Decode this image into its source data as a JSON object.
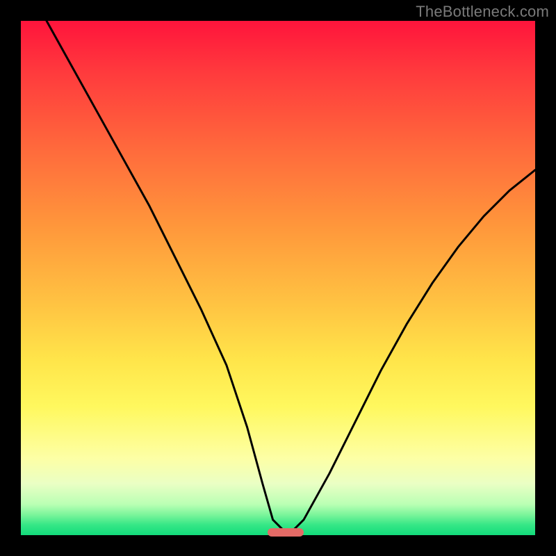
{
  "watermark": "TheBottleneck.com",
  "chart_data": {
    "type": "line",
    "title": "",
    "xlabel": "",
    "ylabel": "",
    "xlim": [
      0,
      100
    ],
    "ylim": [
      0,
      100
    ],
    "grid": false,
    "background_gradient": {
      "direction": "vertical",
      "stops": [
        {
          "pos": 0,
          "color": "#ff143c"
        },
        {
          "pos": 25,
          "color": "#ff6a3c"
        },
        {
          "pos": 55,
          "color": "#ffc342"
        },
        {
          "pos": 75,
          "color": "#fff85e"
        },
        {
          "pos": 96,
          "color": "#7cf59b"
        },
        {
          "pos": 100,
          "color": "#12db7b"
        }
      ]
    },
    "series": [
      {
        "name": "bottleneck-curve",
        "x": [
          5,
          10,
          15,
          20,
          25,
          30,
          35,
          40,
          44,
          47,
          49,
          51,
          53,
          55,
          60,
          65,
          70,
          75,
          80,
          85,
          90,
          95,
          100
        ],
        "y": [
          100,
          91,
          82,
          73,
          64,
          54,
          44,
          33,
          21,
          10,
          3,
          1,
          1,
          3,
          12,
          22,
          32,
          41,
          49,
          56,
          62,
          67,
          71
        ]
      }
    ],
    "marker": {
      "name": "optimal-range",
      "x_start": 48,
      "x_end": 55,
      "y": 0.5,
      "color": "#e36a66"
    }
  }
}
